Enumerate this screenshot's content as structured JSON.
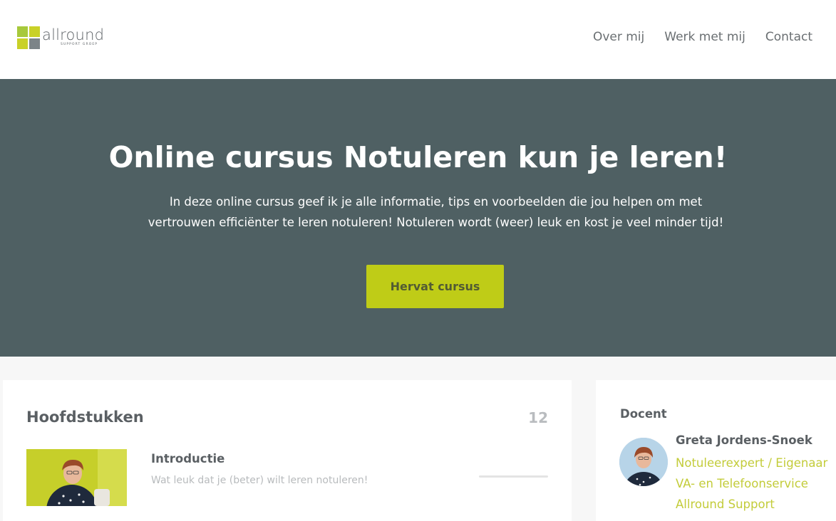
{
  "header": {
    "logo": {
      "name": "allround",
      "subtitle": "SUPPORT GROEP",
      "colors": [
        "#a7c93b",
        "#5d6266",
        "#c9d128",
        "#7c8488"
      ]
    },
    "nav": [
      {
        "label": "Over mij"
      },
      {
        "label": "Werk met mij"
      },
      {
        "label": "Contact"
      }
    ]
  },
  "hero": {
    "title": "Online cursus Notuleren kun je leren!",
    "description": "In deze online cursus geef ik je alle informatie, tips en voorbeelden die jou helpen om met vertrouwen efficiënter te leren notuleren! Notuleren wordt (weer) leuk en kost je veel minder tijd!",
    "button_label": "Hervat cursus",
    "background_color": "#4f6063",
    "accent_color": "#bfcc17"
  },
  "chapters": {
    "title": "Hoofdstukken",
    "count": "12",
    "items": [
      {
        "title": "Introductie",
        "subtitle": "Wat leuk dat je (beter) wilt leren notuleren!",
        "progress": 0
      }
    ]
  },
  "teacher": {
    "label": "Docent",
    "name": "Greta Jordens-Snoek",
    "role": "Notuleerexpert / Eigenaar VA- en Telefoonservice Allround Support"
  }
}
